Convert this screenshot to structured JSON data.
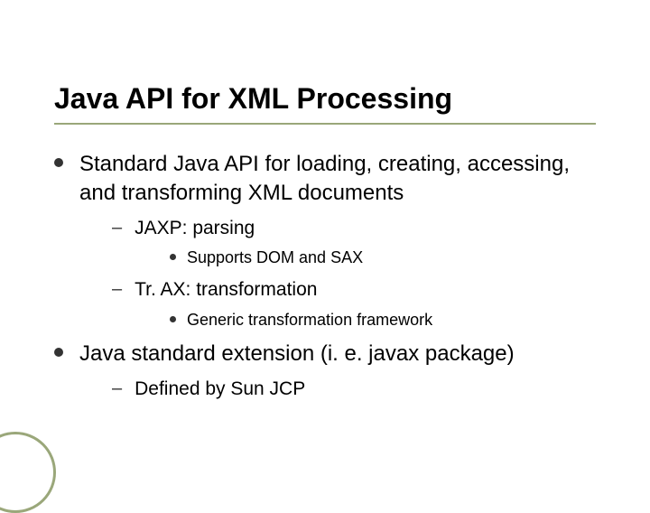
{
  "title": "Java API for XML Processing",
  "bullets": {
    "b1": {
      "text": "Standard Java API for loading, creating, accessing, and transforming XML documents",
      "sub1": {
        "text": "JAXP: parsing",
        "sub": {
          "text": "Supports DOM and SAX"
        }
      },
      "sub2": {
        "text": "Tr. AX: transformation",
        "sub": {
          "text": "Generic transformation framework"
        }
      }
    },
    "b2": {
      "text": "Java standard extension (i. e. javax package)",
      "sub1": {
        "text": "Defined by Sun JCP"
      }
    }
  }
}
